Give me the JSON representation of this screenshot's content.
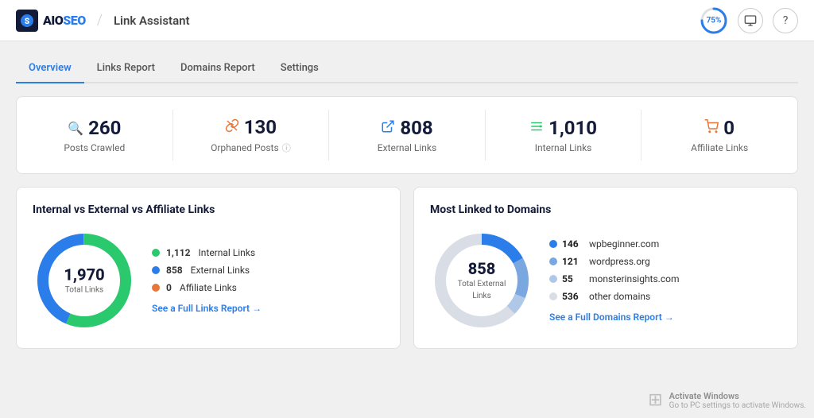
{
  "header": {
    "logo_text": "AIOSEO",
    "divider": "/",
    "page_title": "Link Assistant",
    "progress_value": 75,
    "progress_label": "75%"
  },
  "nav": {
    "tabs": [
      {
        "label": "Overview",
        "active": true
      },
      {
        "label": "Links Report",
        "active": false
      },
      {
        "label": "Domains Report",
        "active": false
      },
      {
        "label": "Settings",
        "active": false
      }
    ]
  },
  "stats": [
    {
      "icon": "search",
      "number": "260",
      "label": "Posts Crawled"
    },
    {
      "icon": "orphan",
      "number": "130",
      "label": "Orphaned Posts"
    },
    {
      "icon": "external",
      "number": "808",
      "label": "External Links"
    },
    {
      "icon": "internal",
      "number": "1,010",
      "label": "Internal Links"
    },
    {
      "icon": "affiliate",
      "number": "0",
      "label": "Affiliate Links"
    }
  ],
  "links_panel": {
    "title": "Internal vs External vs Affiliate Links",
    "total": "1,970",
    "total_label": "Total Links",
    "legend": [
      {
        "color": "#2bc96e",
        "count": "1,112",
        "label": "Internal Links"
      },
      {
        "color": "#2b7de9",
        "count": "858",
        "label": "External Links"
      },
      {
        "color": "#e8763a",
        "count": "0",
        "label": "Affiliate Links"
      }
    ],
    "link_text": "See a Full Links Report →"
  },
  "domains_panel": {
    "title": "Most Linked to Domains",
    "total": "858",
    "total_label": "Total External Links",
    "domains": [
      {
        "color": "#2b7de9",
        "count": "146",
        "name": "wpbeginner.com"
      },
      {
        "color": "#7ba7e0",
        "count": "121",
        "name": "wordpress.org"
      },
      {
        "color": "#b0c8e8",
        "count": "55",
        "name": "monsterinsights.com"
      },
      {
        "color": "#d0d8e4",
        "count": "536",
        "name": "other domains"
      }
    ],
    "link_text": "See a Full Domains Report →"
  }
}
